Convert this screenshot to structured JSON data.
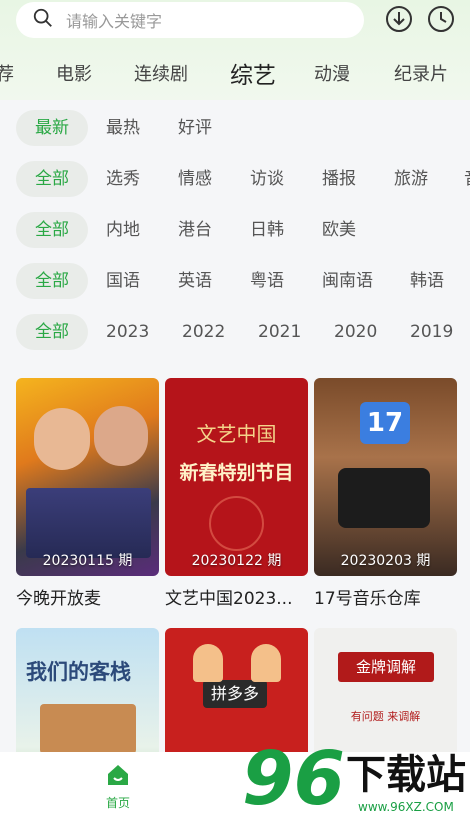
{
  "search": {
    "placeholder": "请输入关键字"
  },
  "tabs": [
    "荐",
    "电影",
    "连续剧",
    "综艺",
    "动漫",
    "纪录片"
  ],
  "active_tab": "综艺",
  "filters": {
    "sort": [
      "最新",
      "最热",
      "好评"
    ],
    "genre": [
      "全部",
      "选秀",
      "情感",
      "访谈",
      "播报",
      "旅游",
      "音"
    ],
    "region": [
      "全部",
      "内地",
      "港台",
      "日韩",
      "欧美"
    ],
    "language": [
      "全部",
      "国语",
      "英语",
      "粤语",
      "闽南语",
      "韩语"
    ],
    "year": [
      "全部",
      "2023",
      "2022",
      "2021",
      "2020",
      "2019"
    ]
  },
  "cards": [
    {
      "title": "今晚开放麦",
      "episode": "20230115 期"
    },
    {
      "title": "文艺中国2023...",
      "episode": "20230122 期"
    },
    {
      "title": "17号音乐仓库",
      "episode": "20230203 期"
    },
    {
      "title": "",
      "episode": ""
    },
    {
      "title": "",
      "episode": ""
    },
    {
      "title": "",
      "episode": ""
    }
  ],
  "poster_text": {
    "card2_line1": "文艺中国",
    "card2_line2": "新春特别节目",
    "card3_badge": "17",
    "card4_text": "我们的客栈",
    "card5_text": "拼多多",
    "card6_text": "金牌调解",
    "card6_sub": "有问题 来调解"
  },
  "nav": {
    "home_label": "首页"
  },
  "watermark": {
    "number": "96",
    "text": "下载站",
    "url": "www.96XZ.COM"
  },
  "colors": {
    "accent": "#2aa845",
    "chip_bg": "#e9ece9"
  }
}
